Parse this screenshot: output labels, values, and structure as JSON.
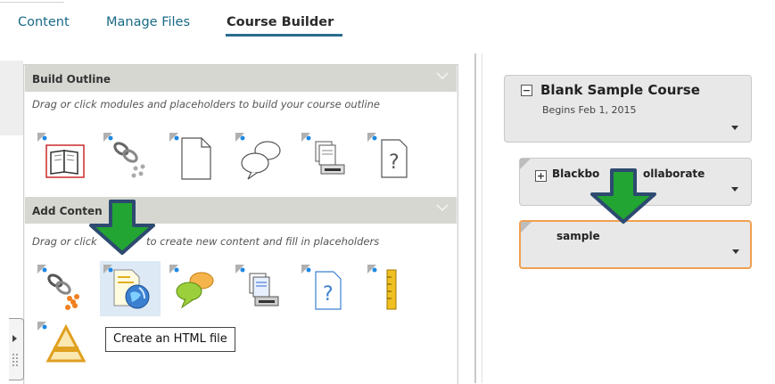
{
  "tabs": [
    {
      "label": "Content"
    },
    {
      "label": "Manage Files"
    },
    {
      "label": "Course Builder",
      "active": true
    }
  ],
  "build_outline": {
    "title": "Build Outline",
    "hint": "Drag or click modules and placeholders to build your course outline",
    "items": [
      {
        "icon": "book-module-icon"
      },
      {
        "icon": "link-placeholder-icon"
      },
      {
        "icon": "blank-document-icon"
      },
      {
        "icon": "discussion-bubbles-icon"
      },
      {
        "icon": "dropbox-tray-icon"
      },
      {
        "icon": "quiz-question-icon"
      }
    ]
  },
  "add_content": {
    "title": "Add Conten",
    "hint_start": "Drag or click",
    "hint_end": "to create new content and fill in placeholders",
    "items": [
      {
        "icon": "link-icon"
      },
      {
        "icon": "html-file-icon",
        "highlighted": true
      },
      {
        "icon": "discussion-icon"
      },
      {
        "icon": "dropbox-icon"
      },
      {
        "icon": "quiz-icon"
      },
      {
        "icon": "ruler-icon"
      },
      {
        "icon": "checklist-icon"
      }
    ],
    "tooltip": "Create an HTML file"
  },
  "course": {
    "title": "Blank Sample Course",
    "subtitle": "Begins Feb 1, 2015",
    "toggle": "−"
  },
  "modules": [
    {
      "title_start": "Blackbo",
      "title_end": "ollaborate",
      "toggle": "+"
    },
    {
      "title": "sample",
      "selected": true
    }
  ],
  "colors": {
    "accent": "#2a6d8f",
    "arrow_fill": "#22a532",
    "arrow_stroke": "#2d4a70",
    "selected_border": "#f0a050"
  }
}
